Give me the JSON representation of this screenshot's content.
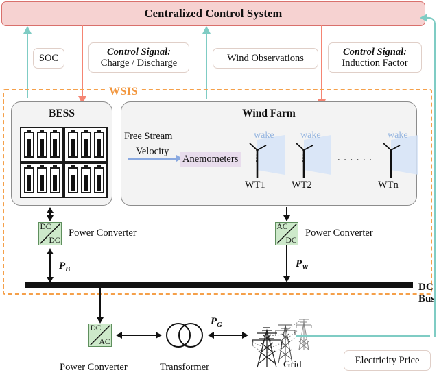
{
  "title": "Centralized Control System",
  "wsis_label": "WSIS",
  "signals": [
    {
      "name": "soc",
      "label": "SOC",
      "prefix": "",
      "direction": "up",
      "color": "#7fccc4"
    },
    {
      "name": "charge-discharge",
      "prefix": "Control Signal:",
      "label": "Charge / Discharge",
      "direction": "down",
      "color": "#f58573"
    },
    {
      "name": "wind-observations",
      "prefix": "",
      "label": "Wind Observations",
      "direction": "up",
      "color": "#7fccc4"
    },
    {
      "name": "induction-factor",
      "prefix": "Control Signal:",
      "label": "Induction Factor",
      "direction": "down",
      "color": "#f58573"
    }
  ],
  "bess": {
    "title": "BESS",
    "pack_count": 4,
    "cells_per_pack": 3
  },
  "wind_farm": {
    "title": "Wind Farm",
    "free_stream_line1": "Free Stream",
    "free_stream_line2": "Velocity",
    "anemometers": "Anemometers",
    "wake_label": "wake",
    "ellipsis": ". . . . . .",
    "turbines": [
      "WT1",
      "WT2",
      "WTn"
    ]
  },
  "converters": {
    "bess": {
      "top": "DC",
      "bottom": "DC",
      "label": "Power Converter"
    },
    "wind": {
      "top": "AC",
      "bottom": "DC",
      "label": "Power Converter"
    },
    "grid": {
      "top": "DC",
      "bottom": "AC",
      "label": "Power Converter"
    }
  },
  "power_flows": {
    "bess": {
      "symbol": "P",
      "sub": "B"
    },
    "wind": {
      "symbol": "P",
      "sub": "W"
    },
    "grid": {
      "symbol": "P",
      "sub": "G"
    }
  },
  "dc_bus": "DC Bus",
  "transformer": "Transformer",
  "grid": "Grid",
  "electricity_price": "Electricity Price",
  "colors": {
    "header_fill": "#f6d2d1",
    "header_border": "#d9706c",
    "wsis_border": "#f5a04a",
    "wsis_text": "#f2973f",
    "teal": "#7fccc4",
    "salmon": "#f58573",
    "converter_fill": "#cde9ca",
    "anemometer_fill": "#e8dcec",
    "wake_fill": "#d5e3f7",
    "wake_text": "#93b4e0"
  }
}
